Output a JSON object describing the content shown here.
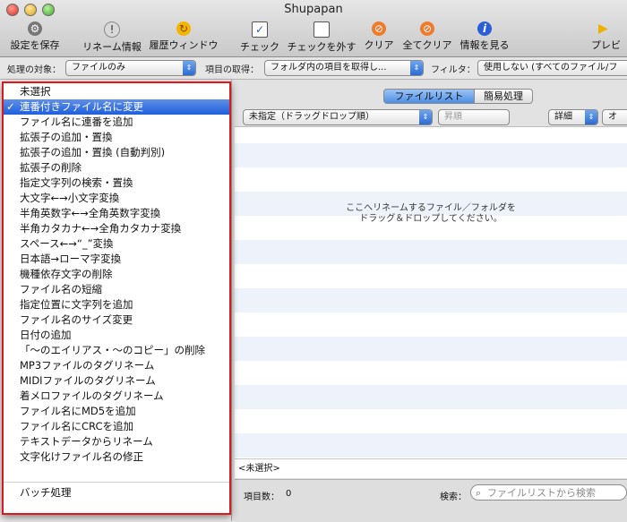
{
  "window": {
    "title": "Shupapan"
  },
  "toolbar": {
    "items": [
      {
        "label": "設定を保存",
        "icon": "gear-icon"
      },
      {
        "label": "リネーム情報",
        "icon": "alert-icon"
      },
      {
        "label": "履歴ウィンドウ",
        "icon": "history-icon"
      },
      {
        "label": "チェック",
        "icon": "checkbox-checked-icon"
      },
      {
        "label": "チェックを外す",
        "icon": "checkbox-empty-icon"
      },
      {
        "label": "クリア",
        "icon": "clear-icon"
      },
      {
        "label": "全てクリア",
        "icon": "clear-all-icon"
      },
      {
        "label": "情報を見る",
        "icon": "info-icon"
      },
      {
        "label": "プレビ",
        "icon": "preview-icon"
      }
    ]
  },
  "options": {
    "target_label": "処理の対象：",
    "target_value": "ファイルのみ",
    "fetch_label": "項目の取得：",
    "fetch_value": "フォルダ内の項目を取得し...",
    "filter_label": "フィルタ：",
    "filter_value": "使用しない (すべてのファイル/フ"
  },
  "menu": {
    "items": [
      "未選択",
      "連番付きファイル名に変更",
      "ファイル名に連番を追加",
      "拡張子の追加・置換",
      "拡張子の追加・置換 (自動判別)",
      "拡張子の削除",
      "指定文字列の検索・置換",
      "大文字←→小文字変換",
      "半角英数字←→全角英数字変換",
      "半角カタカナ←→全角カタカナ変換",
      "スペース←→“_”変換",
      "日本語→ローマ字変換",
      "機種依存文字の削除",
      "ファイル名の短縮",
      "指定位置に文字列を追加",
      "ファイル名のサイズ変更",
      "日付の追加",
      "「〜のエイリアス・〜のコピー」の削除",
      "MP3ファイルのタグリネーム",
      "MIDIファイルのタグリネーム",
      "着メロファイルのタグリネーム",
      "ファイル名にMD5を追加",
      "ファイル名にCRCを追加",
      "テキストデータからリネーム",
      "文字化けファイル名の修正",
      "バッチ処理"
    ],
    "selected_index": 1,
    "check_mark": "✓"
  },
  "tabs": {
    "file_list": "ファイルリスト",
    "simple": "簡易処理"
  },
  "list_controls": {
    "sort_value": "未指定（ドラッグドロップ順）",
    "order_value": "昇順",
    "detail_value": "詳細",
    "option_value": "オ"
  },
  "drop_hint": {
    "line1": "ここへリネームするファイル／フォルダを",
    "line2": "ドラッグ＆ドロップしてください。"
  },
  "pathbar": {
    "text": "<未選択>"
  },
  "status": {
    "count_label": "項目数：",
    "count_value": "0",
    "search_label": "検索：",
    "search_placeholder": "ファイルリストから検索"
  },
  "colors": {
    "highlight": "#e0181d",
    "selection": "#1f5fdc"
  }
}
